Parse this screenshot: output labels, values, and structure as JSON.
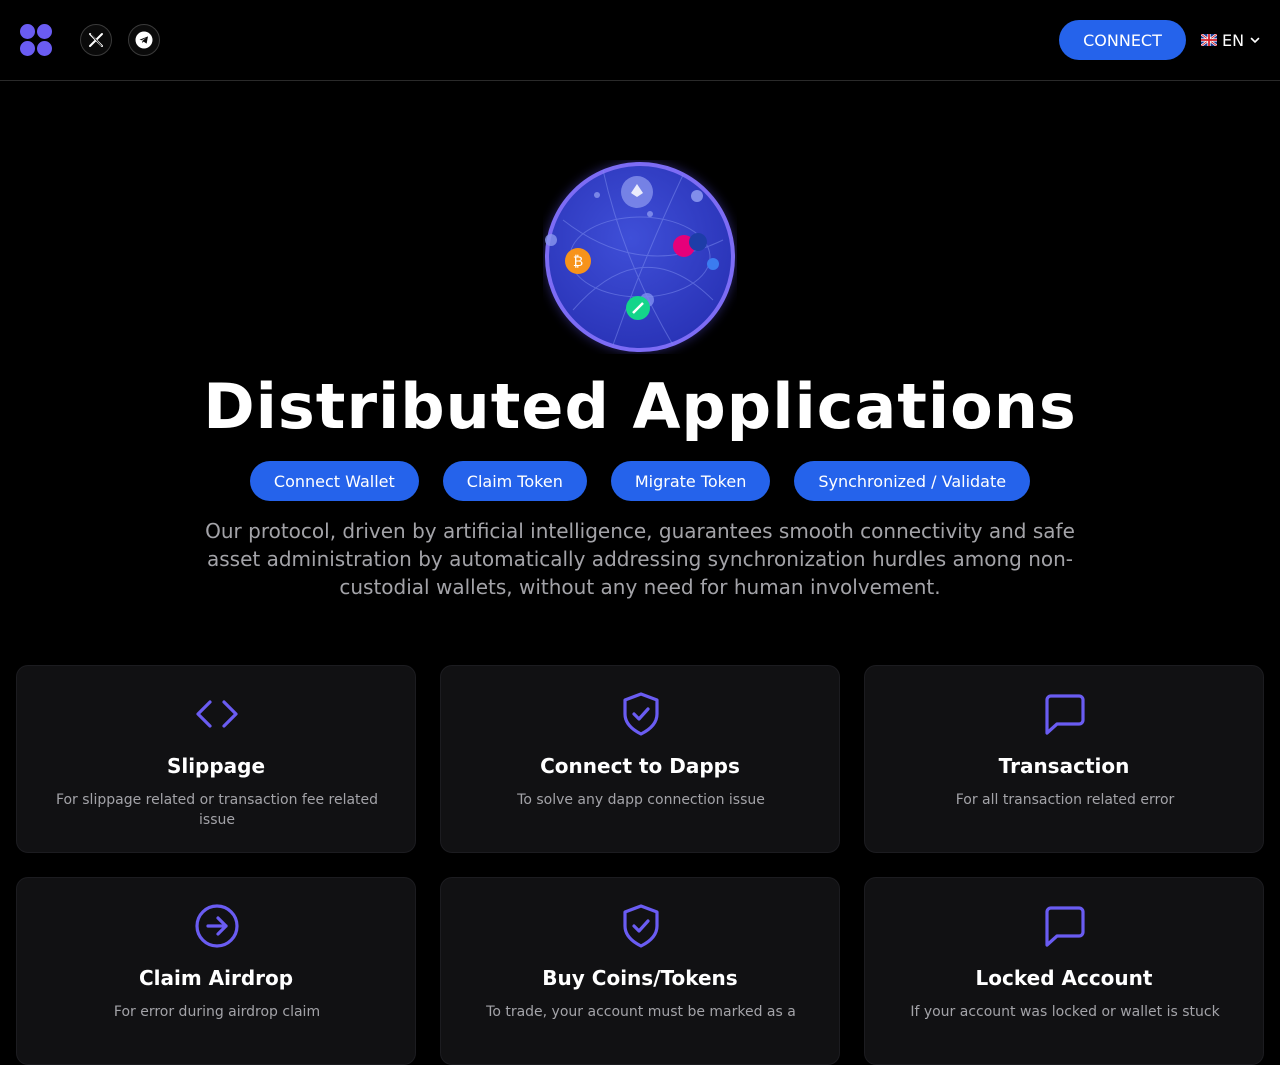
{
  "header": {
    "connect_label": "CONNECT",
    "language": "EN",
    "icons": [
      "logo-icon",
      "x-icon",
      "telegram-icon",
      "uk-flag-icon",
      "chevron-down-icon"
    ]
  },
  "hero": {
    "title": "Distributed Applications",
    "pills": [
      "Connect Wallet",
      "Claim Token",
      "Migrate Token",
      "Synchronized / Validate"
    ],
    "description": "Our protocol, driven by artificial intelligence, guarantees smooth connectivity and safe asset administration by automatically addressing synchronization hurdles among non-custodial wallets, without any need for human involvement."
  },
  "cards": [
    {
      "title": "Slippage",
      "desc": "For slippage related or transaction fee related issue",
      "icon": "code-icon"
    },
    {
      "title": "Connect to Dapps",
      "desc": "To solve any dapp connection issue",
      "icon": "shield-check-icon"
    },
    {
      "title": "Transaction",
      "desc": "For all transaction related error",
      "icon": "message-icon"
    },
    {
      "title": "Claim Airdrop",
      "desc": "For error during airdrop claim",
      "icon": "arrow-right-circle-icon"
    },
    {
      "title": "Buy Coins/Tokens",
      "desc": "To trade, your account must be marked as a",
      "icon": "shield-check-icon"
    },
    {
      "title": "Locked Account",
      "desc": "If your account was locked or wallet is stuck",
      "icon": "message-icon"
    }
  ],
  "colors": {
    "accent": "#2563eb",
    "icon": "#6a5cf2",
    "card_bg": "#111113",
    "muted_text": "#a3a3a8"
  }
}
